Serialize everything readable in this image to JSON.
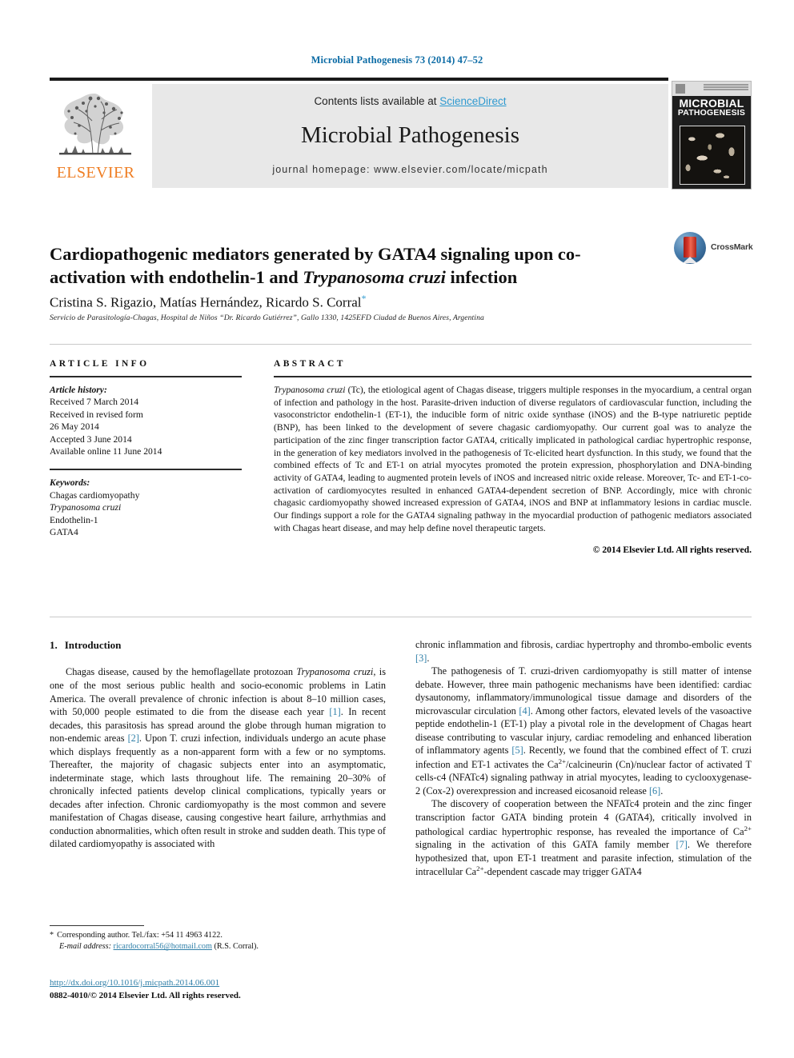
{
  "running_head": "Microbial Pathogenesis 73 (2014) 47–52",
  "masthead": {
    "contents_prefix": "Contents lists available at ",
    "sciencedirect": "ScienceDirect",
    "journal_name": "Microbial Pathogenesis",
    "homepage": "journal homepage: www.elsevier.com/locate/micpath",
    "elsevier_wordmark": "ELSEVIER",
    "cover_title_line1": "MICROBIAL",
    "cover_title_line2": "PATHOGENESIS"
  },
  "article": {
    "title_part1": "Cardiopathogenic mediators generated by GATA4 signaling upon co-activation with endothelin-1 and ",
    "title_italic": "Trypanosoma cruzi",
    "title_part2": " infection",
    "authors": "Cristina S. Rigazio, Matías Hernández, Ricardo S. Corral",
    "corresponding_marker": "*",
    "affiliation": "Servicio de Parasitología-Chagas, Hospital de Niños “Dr. Ricardo Gutiérrez”, Gallo 1330, 1425EFD Ciudad de Buenos Aires, Argentina"
  },
  "crossmark": {
    "label": "CrossMark"
  },
  "article_info": {
    "heading": "ARTICLE INFO",
    "history_label": "Article history:",
    "history": [
      "Received 7 March 2014",
      "Received in revised form",
      "26 May 2014",
      "Accepted 3 June 2014",
      "Available online 11 June 2014"
    ],
    "keywords_label": "Keywords:",
    "keywords": [
      "Chagas cardiomyopathy",
      "Trypanosoma cruzi",
      "Endothelin-1",
      "GATA4"
    ]
  },
  "abstract": {
    "heading": "ABSTRACT",
    "text_lead_italic": "Trypanosoma cruzi",
    "text": " (Tc), the etiological agent of Chagas disease, triggers multiple responses in the myocardium, a central organ of infection and pathology in the host. Parasite-driven induction of diverse regulators of cardiovascular function, including the vasoconstrictor endothelin-1 (ET-1), the inducible form of nitric oxide synthase (iNOS) and the B-type natriuretic peptide (BNP), has been linked to the development of severe chagasic cardiomyopathy. Our current goal was to analyze the participation of the zinc finger transcription factor GATA4, critically implicated in pathological cardiac hypertrophic response, in the generation of key mediators involved in the pathogenesis of Tc-elicited heart dysfunction. In this study, we found that the combined effects of Tc and ET-1 on atrial myocytes promoted the protein expression, phosphorylation and DNA-binding activity of GATA4, leading to augmented protein levels of iNOS and increased nitric oxide release. Moreover, Tc- and ET-1-co-activation of cardiomyocytes resulted in enhanced GATA4-dependent secretion of BNP. Accordingly, mice with chronic chagasic cardiomyopathy showed increased expression of GATA4, iNOS and BNP at inflammatory lesions in cardiac muscle. Our findings support a role for the GATA4 signaling pathway in the myocardial production of pathogenic mediators associated with Chagas heart disease, and may help define novel therapeutic targets.",
    "copyright": "© 2014 Elsevier Ltd. All rights reserved."
  },
  "body": {
    "section_number": "1.",
    "section_title": "Introduction",
    "left_para_1_a": "Chagas disease, caused by the hemoflagellate protozoan ",
    "left_para_1_italic": "Trypanosoma cruzi",
    "left_para_1_b": ", is one of the most serious public health and socio-economic problems in Latin America. The overall prevalence of chronic infection is about 8–10 million cases, with 50,000 people estimated to die from the disease each year ",
    "ref1": "[1]",
    "left_para_1_c": ". In recent decades, this parasitosis has spread around the globe through human migration to non-endemic areas ",
    "ref2": "[2]",
    "left_para_1_d": ". Upon T. cruzi infection, individuals undergo an acute phase which displays frequently as a non-apparent form with a few or no symptoms. Thereafter, the majority of chagasic subjects enter into an asymptomatic, indeterminate stage, which lasts throughout life. The remaining 20–30% of chronically infected patients develop clinical complications, typically years or decades after infection. Chronic cardiomyopathy is the most common and severe manifestation of Chagas disease, causing congestive heart failure, arrhythmias and conduction abnormalities, which often result in stroke and sudden death. This type of dilated cardiomyopathy is associated with",
    "right_para_1_a": "chronic inflammation and fibrosis, cardiac hypertrophy and thrombo-embolic events ",
    "ref3": "[3]",
    "right_para_1_b": ".",
    "right_para_2_a": "The pathogenesis of T. cruzi-driven cardiomyopathy is still matter of intense debate. However, three main pathogenic mechanisms have been identified: cardiac dysautonomy, inflammatory/immunological tissue damage and disorders of the microvascular circulation ",
    "ref4": "[4]",
    "right_para_2_b": ". Among other factors, elevated levels of the vasoactive peptide endothelin-1 (ET-1) play a pivotal role in the development of Chagas heart disease contributing to vascular injury, cardiac remodeling and enhanced liberation of inflammatory agents ",
    "ref5": "[5]",
    "right_para_2_c": ". Recently, we found that the combined effect of T. cruzi infection and ET-1 activates the Ca",
    "sup_2plus": "2+",
    "right_para_2_d": "/calcineurin (Cn)/nuclear factor of activated T cells-c4 (NFATc4) signaling pathway in atrial myocytes, leading to cyclooxygenase-2 (Cox-2) overexpression and increased eicosanoid release ",
    "ref6": "[6]",
    "right_para_2_e": ".",
    "right_para_3_a": "The discovery of cooperation between the NFATc4 protein and the zinc finger transcription factor GATA binding protein 4 (GATA4), critically involved in pathological cardiac hypertrophic response, has revealed the importance of Ca",
    "right_para_3_b": " signaling in the activation of this GATA family member ",
    "ref7": "[7]",
    "right_para_3_c": ". We therefore hypothesized that, upon ET-1 treatment and parasite infection, stimulation of the intracellular Ca",
    "right_para_3_d": "-dependent cascade may trigger GATA4"
  },
  "footer": {
    "corresponding_star": "*",
    "corresponding_text": "Corresponding author. Tel./fax: +54 11 4963 4122.",
    "email_label": "E-mail address:",
    "email": "ricardocorral56@hotmail.com",
    "email_suffix": "(R.S. Corral).",
    "doi": "http://dx.doi.org/10.1016/j.micpath.2014.06.001",
    "issn_line": "0882-4010/© 2014 Elsevier Ltd. All rights reserved."
  }
}
